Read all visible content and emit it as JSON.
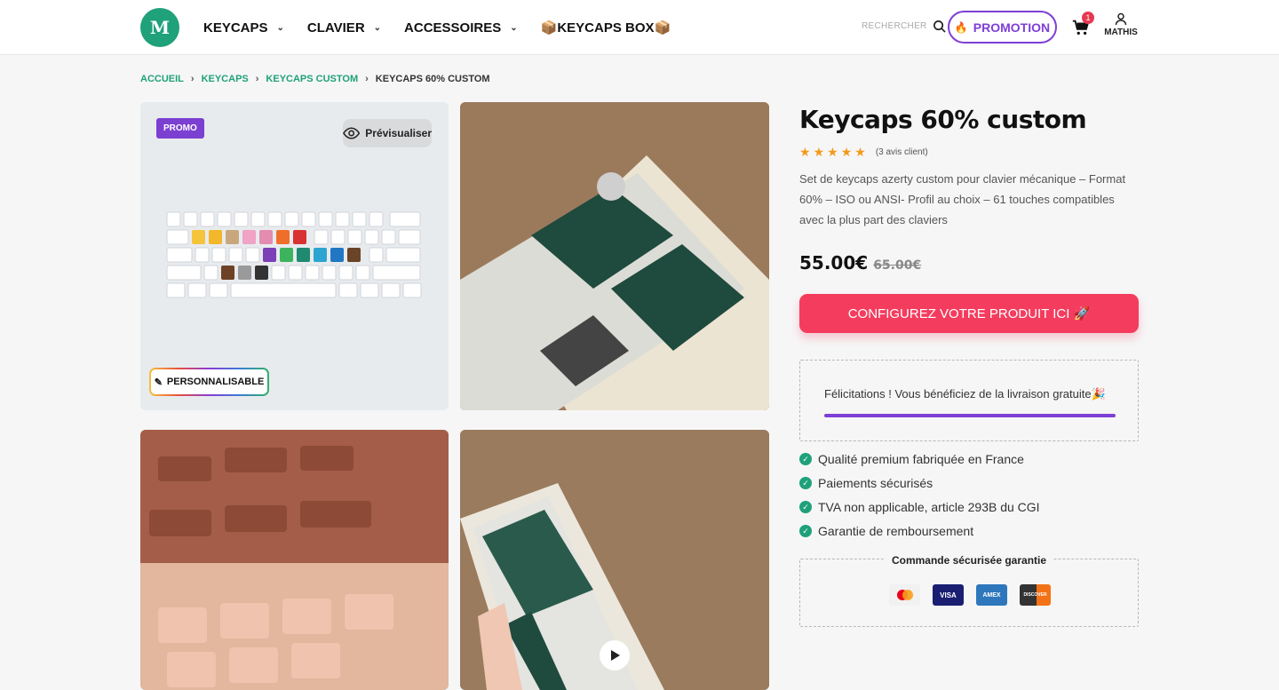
{
  "header": {
    "logo": "M",
    "nav": [
      {
        "label": "KEYCAPS"
      },
      {
        "label": "CLAVIER"
      },
      {
        "label": "ACCESSOIRES"
      },
      {
        "label": "📦KEYCAPS BOX📦"
      }
    ],
    "search_label": "RECHERCHER",
    "promotion_label": "PROMOTION",
    "cart_count": "1",
    "account_label": "MATHIS"
  },
  "breadcrumb": [
    "ACCUEIL",
    "KEYCAPS",
    "KEYCAPS CUSTOM",
    "KEYCAPS 60% CUSTOM"
  ],
  "gallery": {
    "promo_badge": "PROMO",
    "preview_label": "Prévisualiser",
    "personal_badge": "PERSONNALISABLE"
  },
  "product": {
    "title": "Keycaps 60% custom",
    "rating": 5,
    "reviews": "(3 avis client)",
    "description": "Set de keycaps azerty custom pour clavier mécanique – Format 60% – ISO ou ANSI- Profil au choix – 61 touches compatibles avec la plus part des claviers",
    "price_now": "55.00€",
    "price_old": "65.00€",
    "config_button": "CONFIGUREZ VOTRE PRODUIT ICI 🚀",
    "shipping_text": "Félicitations ! Vous bénéficiez de la livraison gratuite🎉",
    "features": [
      "Qualité premium fabriquée en France",
      "Paiements sécurisés",
      "TVA non applicable, article 293B du CGI",
      "Garantie de remboursement"
    ],
    "secure_title": "Commande sécurisée garantie",
    "payments": [
      "mastercard-icon",
      "visa-icon",
      "amex-icon",
      "discover-icon"
    ],
    "payment_labels": [
      "",
      "VISA",
      "AMEX",
      "DISCOVER"
    ]
  },
  "colors": {
    "brand_green": "#1fa17a",
    "promo_purple": "#7e3fd6",
    "cta_pink": "#f43c5e"
  }
}
